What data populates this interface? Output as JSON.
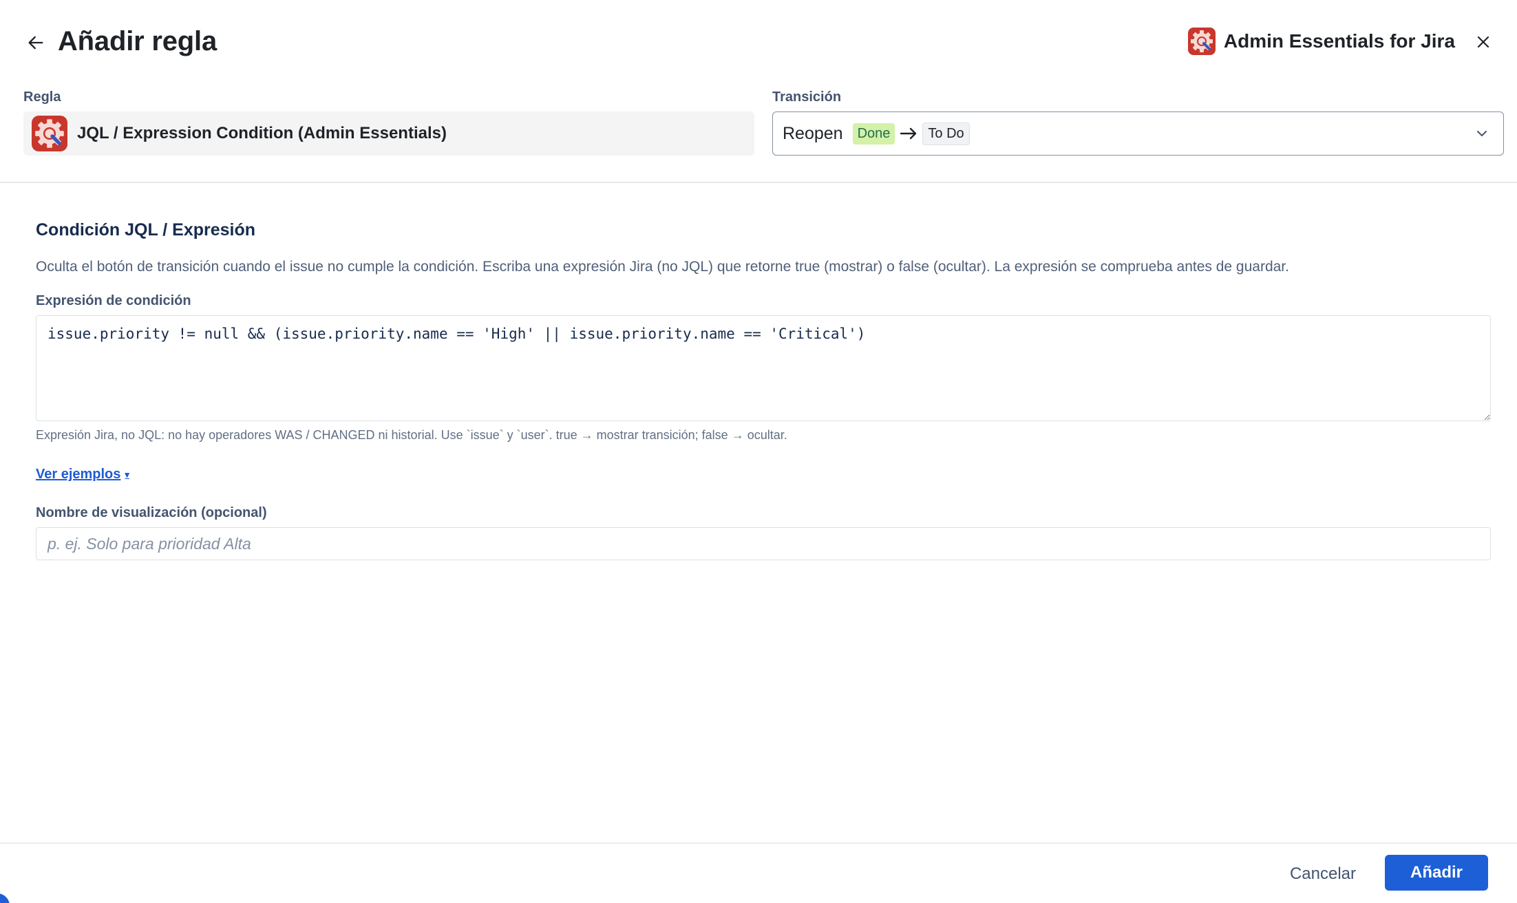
{
  "header": {
    "title": "Añadir regla",
    "brand_name": "Admin Essentials for Jira",
    "back_icon": "arrow-left-icon",
    "close_icon": "close-icon"
  },
  "rule": {
    "label": "Regla",
    "name": "JQL / Expression Condition (Admin Essentials)",
    "icon": "admin-essentials-logo-icon"
  },
  "transition": {
    "label": "Transición",
    "name": "Reopen",
    "from_status": "Done",
    "to_status": "To Do",
    "chevron_icon": "chevron-down-icon"
  },
  "condition": {
    "title": "Condición JQL / Expresión",
    "description": "Oculta el botón de transición cuando el issue no cumple la condición. Escriba una expresión Jira (no JQL) que retorne true (mostrar) o false (ocultar). La expresión se comprueba antes de guardar.",
    "expression_label": "Expresión de condición",
    "expression_value": "issue.priority != null && (issue.priority.name == 'High' || issue.priority.name == 'Critical')",
    "help_text": "Expresión Jira, no JQL: no hay operadores WAS / CHANGED ni historial. Use `issue` y `user`. true → mostrar transición; false → ocultar.",
    "examples_link": "Ver ejemplos",
    "display_name_label": "Nombre de visualización (opcional)",
    "display_name_placeholder": "p. ej. Solo para prioridad Alta",
    "display_name_value": ""
  },
  "footer": {
    "cancel_label": "Cancelar",
    "add_label": "Añadir"
  },
  "colors": {
    "primary": "#1d5fd6",
    "link": "#1d5bd6",
    "done_status_bg": "#d3f1a7",
    "logo_red": "#c9372c"
  }
}
